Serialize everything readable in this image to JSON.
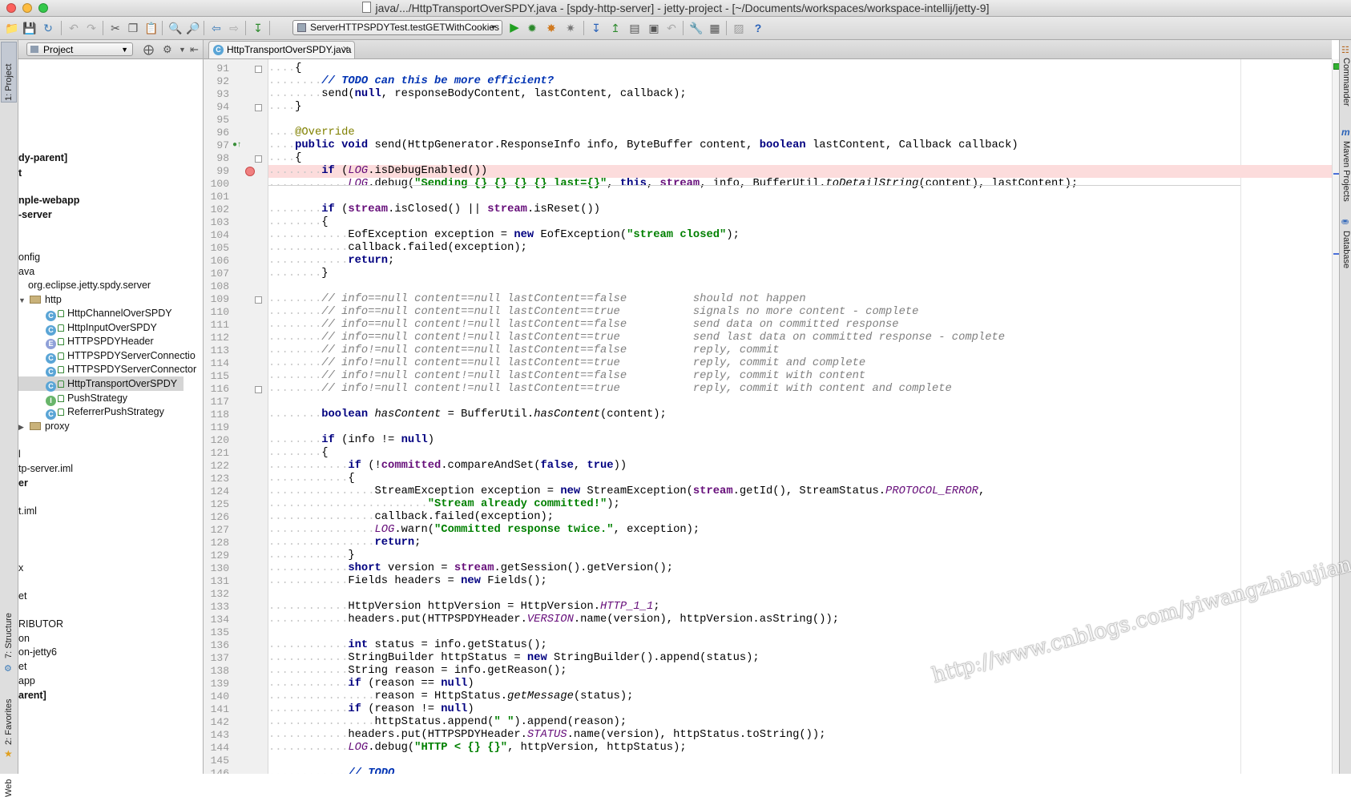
{
  "window": {
    "title": "java/.../HttpTransportOverSPDY.java - [spdy-http-server] - jetty-project - [~/Documents/workspaces/workspace-intellij/jetty-9]"
  },
  "toolbar": {
    "run_config": "ServerHTTPSPDYTest.testGETWithCookies"
  },
  "left_strip": {
    "project_tab": "1: Project",
    "structure_tab": "7: Structure",
    "favorites_tab": "2: Favorites",
    "web_tab": "Web"
  },
  "right_strip": {
    "commander_tab": "Commander",
    "maven_tab": "Maven Projects",
    "database_tab": "Database"
  },
  "project_panel": {
    "view_selector": "Project",
    "tree": [
      {
        "label": "dy-parent]",
        "bold": true
      },
      {
        "label": "t",
        "bold": true
      },
      {
        "label": "nple-webapp",
        "bold": true
      },
      {
        "label": "-server",
        "bold": true
      },
      {
        "label": "onfig"
      },
      {
        "label": "ava"
      },
      {
        "label": "org.eclipse.jetty.spdy.server"
      },
      {
        "label": "http"
      },
      {
        "label": "HttpChannelOverSPDY",
        "kind": "C"
      },
      {
        "label": "HttpInputOverSPDY",
        "kind": "C"
      },
      {
        "label": "HTTPSPDYHeader",
        "kind": "E"
      },
      {
        "label": "HTTPSPDYServerConnectio",
        "kind": "C"
      },
      {
        "label": "HTTPSPDYServerConnector",
        "kind": "C"
      },
      {
        "label": "HttpTransportOverSPDY",
        "kind": "C",
        "selected": true
      },
      {
        "label": "PushStrategy",
        "kind": "I"
      },
      {
        "label": "ReferrerPushStrategy",
        "kind": "C"
      },
      {
        "label": "proxy"
      },
      {
        "label": "l"
      },
      {
        "label": "tp-server.iml"
      },
      {
        "label": "er",
        "bold": true
      },
      {
        "label": "t.iml"
      },
      {
        "label": "x"
      },
      {
        "label": "et"
      },
      {
        "label": "RIBUTOR"
      },
      {
        "label": "on"
      },
      {
        "label": "on-jetty6"
      },
      {
        "label": "et"
      },
      {
        "label": "app"
      },
      {
        "label": "arent]",
        "bold": true
      }
    ]
  },
  "editor": {
    "tab_label": "HttpTransportOverSPDY.java",
    "first_line": 91,
    "breakpoint_line": 99,
    "lines": [
      "{",
      "// TODO can this be more efficient?",
      "send(null, responseBodyContent, lastContent, callback);",
      "}",
      "",
      "@Override",
      "public void send(HttpGenerator.ResponseInfo info, ByteBuffer content, boolean lastContent, Callback callback)",
      "{",
      "if (LOG.isDebugEnabled())",
      "LOG.debug(\"Sending {} {} {} {} last={}\", this, stream, info, BufferUtil.toDetailString(content), lastContent);",
      "",
      "if (stream.isClosed() || stream.isReset())",
      "{",
      "EofException exception = new EofException(\"stream closed\");",
      "callback.failed(exception);",
      "return;",
      "}",
      "",
      "// info==null content==null lastContent==false          should not happen",
      "// info==null content==null lastContent==true           signals no more content - complete",
      "// info==null content!=null lastContent==false          send data on committed response",
      "// info==null content!=null lastContent==true           send last data on committed response - complete",
      "// info!=null content==null lastContent==false          reply, commit",
      "// info!=null content==null lastContent==true           reply, commit and complete",
      "// info!=null content!=null lastContent==false          reply, commit with content",
      "// info!=null content!=null lastContent==true           reply, commit with content and complete",
      "",
      "boolean hasContent = BufferUtil.hasContent(content);",
      "",
      "if (info != null)",
      "{",
      "if (!committed.compareAndSet(false, true))",
      "{",
      "StreamException exception = new StreamException(stream.getId(), StreamStatus.PROTOCOL_ERROR,",
      "\"Stream already committed!\");",
      "callback.failed(exception);",
      "LOG.warn(\"Committed response twice.\", exception);",
      "return;",
      "}",
      "short version = stream.getSession().getVersion();",
      "Fields headers = new Fields();",
      "",
      "HttpVersion httpVersion = HttpVersion.HTTP_1_1;",
      "headers.put(HTTPSPDYHeader.VERSION.name(version), httpVersion.asString());",
      "",
      "int status = info.getStatus();",
      "StringBuilder httpStatus = new StringBuilder().append(status);",
      "String reason = info.getReason();",
      "if (reason == null)",
      "reason = HttpStatus.getMessage(status);",
      "if (reason != null)",
      "httpStatus.append(\" \").append(reason);",
      "headers.put(HTTPSPDYHeader.STATUS.name(version), httpStatus.toString());",
      "LOG.debug(\"HTTP < {} {}\", httpVersion, httpStatus);",
      "",
      "// TODO"
    ]
  },
  "watermark": "http://www.cnblogs.com/yiwangzhibujian/"
}
